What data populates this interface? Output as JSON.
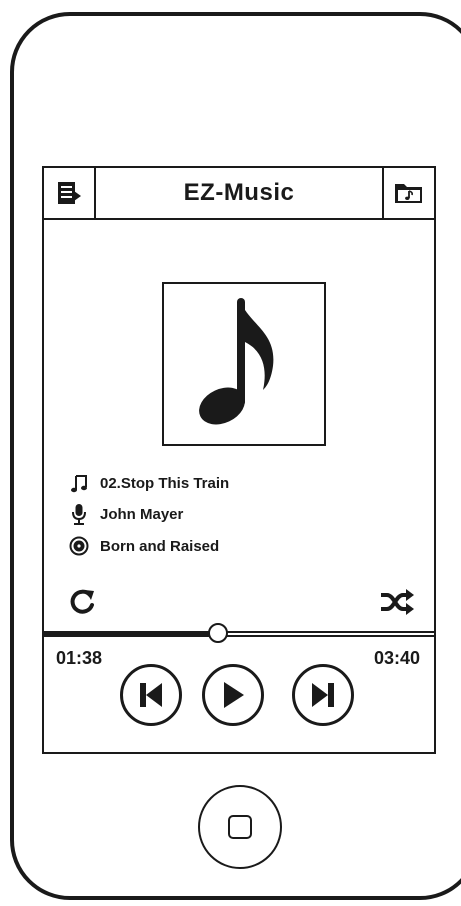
{
  "app": {
    "title": "EZ-Music"
  },
  "track": {
    "title": "02.Stop This Train",
    "artist": "John Mayer",
    "album": "Born and Raised"
  },
  "playback": {
    "elapsed": "01:38",
    "duration": "03:40",
    "progress_fraction": 0.445
  },
  "icons": {
    "playlist": "playlist-icon",
    "folder": "music-folder-icon",
    "album_art": "music-note-icon",
    "title": "music-notes-icon",
    "artist": "microphone-icon",
    "album": "disc-icon",
    "repeat": "repeat-icon",
    "shuffle": "shuffle-icon",
    "previous": "skip-previous-icon",
    "play": "play-icon",
    "next": "skip-next-icon",
    "home": "home-button"
  },
  "colors": {
    "ink": "#1a1a1a",
    "background": "#ffffff"
  }
}
